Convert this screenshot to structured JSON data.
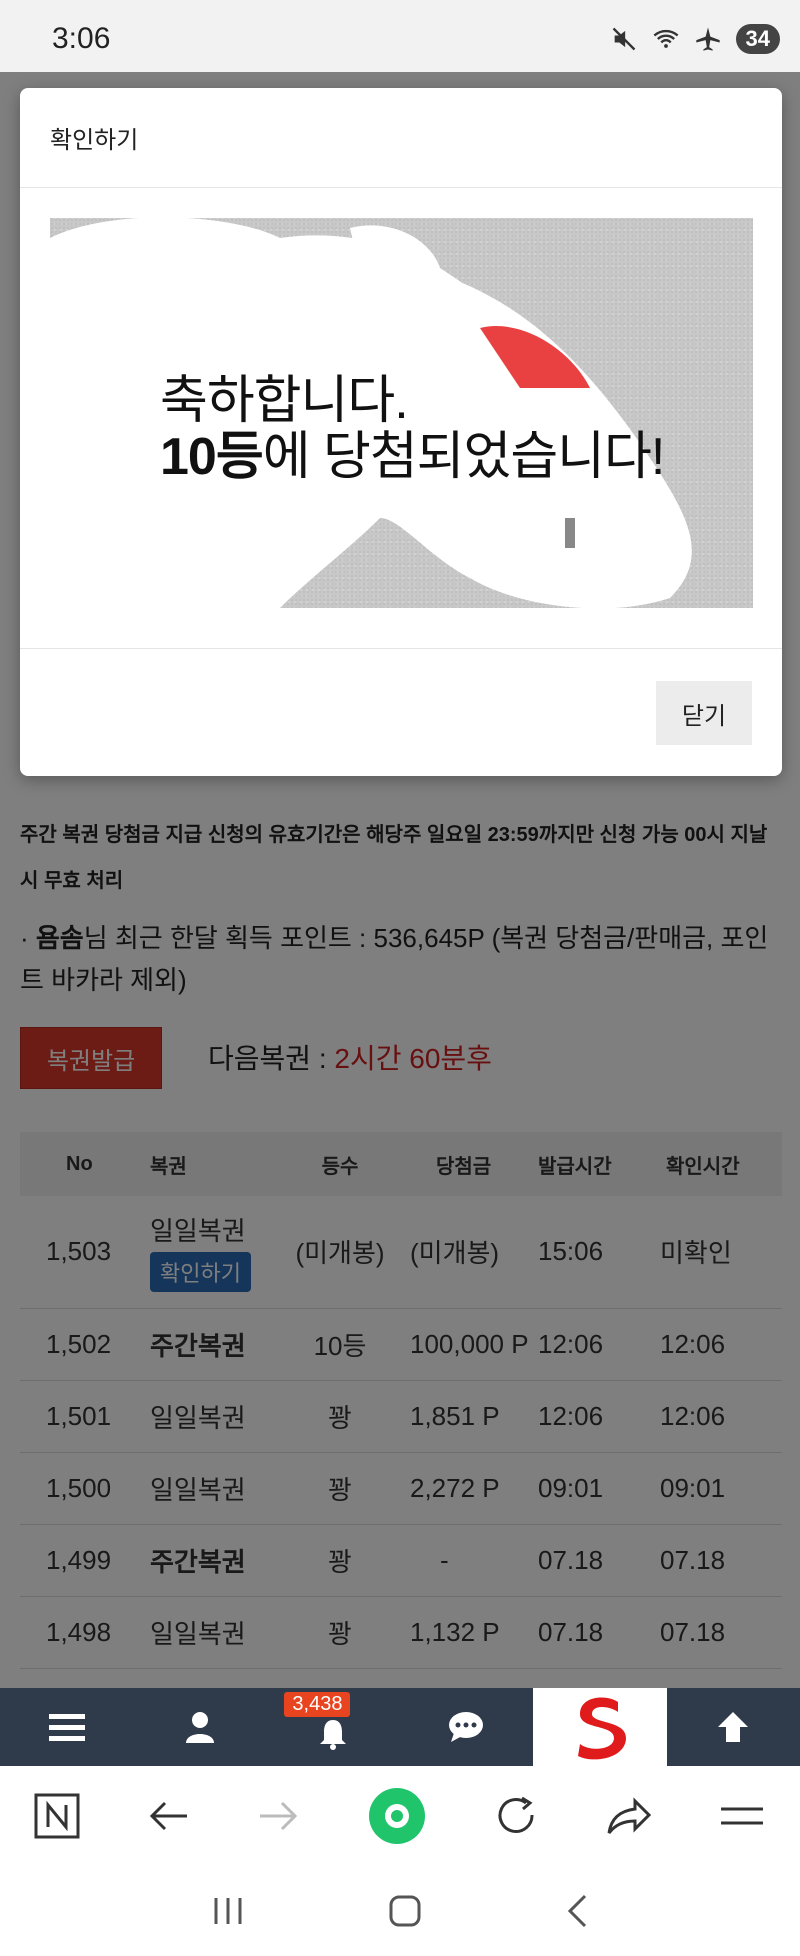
{
  "status_bar": {
    "time": "3:06",
    "battery": "34"
  },
  "modal": {
    "title": "확인하기",
    "message_line1": "축하합니다.",
    "message_line2_bold": "10등",
    "message_line2_rest": "에 당첨되었습니다!",
    "close_label": "닫기"
  },
  "notice": "주간 복권 당첨금 지급 신청의 유효기간은 해당주 일요일 23:59까지만 신청 가능 00시 지날시 무효 처리",
  "points": {
    "prefix": "· ",
    "user": "욤솜",
    "text": "님 최근 한달 획득 포인트 : 536,645P (복권 당첨금/판매금, 포인트 바카라 제외)"
  },
  "issue_button": "복권발급",
  "next_ticket": {
    "label": "다음복권 : ",
    "time": "2시간 60분후"
  },
  "table": {
    "headers": [
      "No",
      "복권",
      "등수",
      "당첨금",
      "발급시간",
      "확인시간"
    ],
    "rows": [
      {
        "no": "1,503",
        "type": "일일복권",
        "badge": "확인하기",
        "rank": "(미개봉)",
        "prize": "(미개봉)",
        "issued": "15:06",
        "checked": "미확인"
      },
      {
        "no": "1,502",
        "type": "주간복권",
        "rank": "10등",
        "prize": "100,000 P",
        "issued": "12:06",
        "checked": "12:06"
      },
      {
        "no": "1,501",
        "type": "일일복권",
        "rank": "꽝",
        "prize": "1,851 P",
        "issued": "12:06",
        "checked": "12:06"
      },
      {
        "no": "1,500",
        "type": "일일복권",
        "rank": "꽝",
        "prize": "2,272 P",
        "issued": "09:01",
        "checked": "09:01"
      },
      {
        "no": "1,499",
        "type": "주간복권",
        "rank": "꽝",
        "prize": "-",
        "issued": "07.18",
        "checked": "07.18"
      },
      {
        "no": "1,498",
        "type": "일일복권",
        "rank": "꽝",
        "prize": "1,132 P",
        "issued": "07.18",
        "checked": "07.18"
      }
    ]
  },
  "site_toolbar": {
    "notification_count": "3,438"
  },
  "colors": {
    "accent_red": "#d8382a",
    "toolbar_bg": "#2f3a4a",
    "badge_blue": "#2b6cb5",
    "unconfirmed_orange": "#e89214",
    "browser_green": "#1fc46b"
  }
}
